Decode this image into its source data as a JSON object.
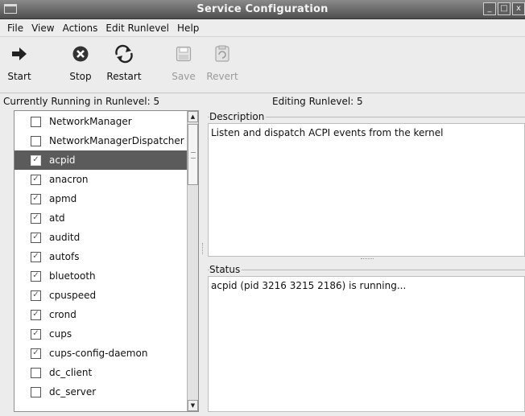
{
  "window": {
    "title": "Service Configuration",
    "buttons": {
      "minimize": "_",
      "maximize": "□",
      "close": "x"
    }
  },
  "menubar": [
    {
      "label": "File"
    },
    {
      "label": "View"
    },
    {
      "label": "Actions"
    },
    {
      "label": "Edit Runlevel"
    },
    {
      "label": "Help"
    }
  ],
  "toolbar": {
    "start": "Start",
    "stop": "Stop",
    "restart": "Restart",
    "save": "Save",
    "revert": "Revert"
  },
  "runlevel": {
    "current": "Currently Running in Runlevel: 5",
    "editing": "Editing Runlevel: 5"
  },
  "services": [
    {
      "name": "NetworkManager",
      "checked": false,
      "selected": false
    },
    {
      "name": "NetworkManagerDispatcher",
      "checked": false,
      "selected": false
    },
    {
      "name": "acpid",
      "checked": true,
      "selected": true
    },
    {
      "name": "anacron",
      "checked": true,
      "selected": false
    },
    {
      "name": "apmd",
      "checked": true,
      "selected": false
    },
    {
      "name": "atd",
      "checked": true,
      "selected": false
    },
    {
      "name": "auditd",
      "checked": true,
      "selected": false
    },
    {
      "name": "autofs",
      "checked": true,
      "selected": false
    },
    {
      "name": "bluetooth",
      "checked": true,
      "selected": false
    },
    {
      "name": "cpuspeed",
      "checked": true,
      "selected": false
    },
    {
      "name": "crond",
      "checked": true,
      "selected": false
    },
    {
      "name": "cups",
      "checked": true,
      "selected": false
    },
    {
      "name": "cups-config-daemon",
      "checked": true,
      "selected": false
    },
    {
      "name": "dc_client",
      "checked": false,
      "selected": false
    },
    {
      "name": "dc_server",
      "checked": false,
      "selected": false
    }
  ],
  "description": {
    "label": "Description",
    "text": "Listen and dispatch ACPI events from the kernel"
  },
  "status": {
    "label": "Status",
    "text": "acpid (pid 3216 3215 2186) is running..."
  },
  "icons": {
    "start": "arrow-right-icon",
    "stop": "stop-circle-icon",
    "restart": "restart-arrows-icon",
    "save": "floppy-disk-icon",
    "revert": "revert-icon"
  }
}
